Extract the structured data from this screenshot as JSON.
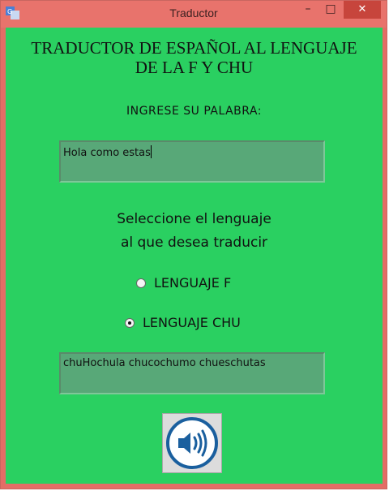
{
  "window": {
    "title": "Traductor",
    "controls": {
      "minimize": "–",
      "maximize": "□",
      "close": "✕"
    }
  },
  "main": {
    "heading_line1": "TRADUCTOR DE ESPAÑOL AL LENGUAJE",
    "heading_line2": "DE LA F Y CHU",
    "prompt": "INGRESE SU PALABRA:",
    "input_value": "Hola como estas",
    "select_line1": "Seleccione el lenguaje",
    "select_line2": "al que desea traducir",
    "options": [
      {
        "label": "LENGUAJE F",
        "checked": false
      },
      {
        "label": "LENGUAJE CHU",
        "checked": true
      }
    ],
    "output_value": "chuHochula chucochumo chueschutas",
    "speak_icon": "speaker-icon"
  },
  "colors": {
    "client_bg": "#2ad061",
    "textbox_bg": "#58a878",
    "titlebar_bg": "#e8736c",
    "close_bg": "#c7453c",
    "speaker_blue": "#1a5f9e"
  }
}
